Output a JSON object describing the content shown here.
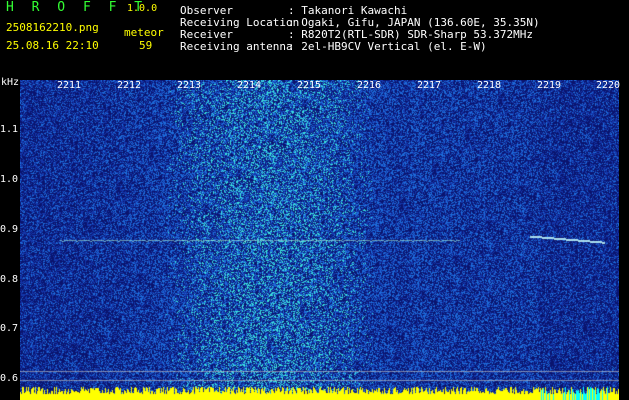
{
  "app": {
    "title": "H R O F F T",
    "version": "1.0.0"
  },
  "file": {
    "name": "2508162210.png",
    "mode": "meteor",
    "timestamp": "25.08.16 22:10",
    "count": "59"
  },
  "info": [
    {
      "label": "Observer",
      "value": ": Takanori Kawachi"
    },
    {
      "label": "Receiving Location",
      "value": ": Ogaki, Gifu, JAPAN (136.60E, 35.35N)"
    },
    {
      "label": "Receiver",
      "value": ": R820T2(RTL-SDR) SDR-Sharp 53.372MHz"
    },
    {
      "label": "Receiving antenna",
      "value": ": 2el-HB9CV Vertical (el. E-W)"
    }
  ],
  "axis": {
    "unit": "kHz",
    "time_ticks": [
      "2211",
      "2212",
      "2213",
      "2214",
      "2215",
      "2216",
      "2217",
      "2218",
      "2219",
      "2220"
    ],
    "freq_ticks": [
      "1.1",
      "1.0",
      "0.9",
      "0.8",
      "0.7",
      "0.6"
    ]
  },
  "colors": {
    "background": "#000000",
    "label": "#ffffff",
    "value": "#ffff00",
    "accent": "#33ff33",
    "spectro_dark": "#000066",
    "spectro_mid": "#1a4dcc",
    "spectro_hot": "#00ffff",
    "baseline": "#ffff00"
  }
}
